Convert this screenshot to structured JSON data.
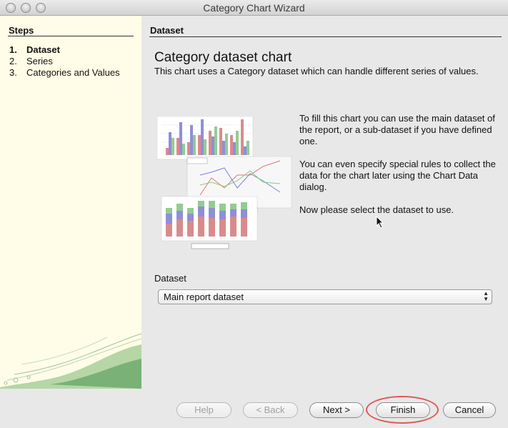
{
  "window": {
    "title": "Category Chart Wizard"
  },
  "sidebar": {
    "heading": "Steps",
    "steps": [
      {
        "num": "1.",
        "label": "Dataset"
      },
      {
        "num": "2.",
        "label": "Series"
      },
      {
        "num": "3.",
        "label": "Categories and Values"
      }
    ],
    "active_step": 1
  },
  "panel": {
    "heading": "Dataset",
    "title": "Category dataset chart",
    "description": "This chart uses a Category dataset which can handle different series of values.",
    "info": [
      "To fill this chart you can use the main dataset of the report, or a sub-dataset if you have defined one.",
      "You can even specify special rules to collect the data for the chart later using the Chart Data dialog.",
      "Now please select the dataset to use."
    ],
    "dataset_label": "Dataset",
    "dataset_value": "Main report dataset"
  },
  "buttons": {
    "help": "Help",
    "back": "< Back",
    "next": "Next >",
    "finish": "Finish",
    "cancel": "Cancel"
  },
  "colors": {
    "sidebar_bg": "#fffde7",
    "highlight_ring": "#e05858",
    "series_red": "#d98b8b",
    "series_blue": "#8f8fd8",
    "series_green": "#93cc93"
  }
}
